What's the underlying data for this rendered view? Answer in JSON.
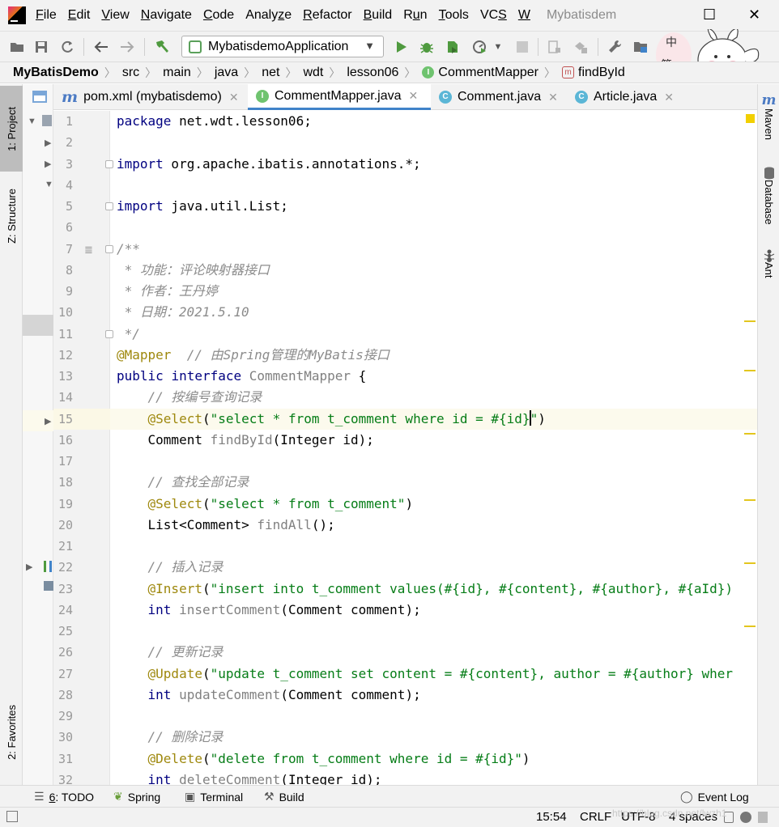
{
  "menubar": {
    "items": [
      {
        "label": "File",
        "mnemonic": "F"
      },
      {
        "label": "Edit",
        "mnemonic": "E"
      },
      {
        "label": "View",
        "mnemonic": "V"
      },
      {
        "label": "Navigate",
        "mnemonic": "N"
      },
      {
        "label": "Code",
        "mnemonic": "C"
      },
      {
        "label": "Analyze",
        "mnemonic": "z"
      },
      {
        "label": "Refactor",
        "mnemonic": "R"
      },
      {
        "label": "Build",
        "mnemonic": "B"
      },
      {
        "label": "Run",
        "mnemonic": "u"
      },
      {
        "label": "Tools",
        "mnemonic": "T"
      },
      {
        "label": "VCS",
        "mnemonic": "S"
      },
      {
        "label": "W",
        "mnemonic": "W"
      }
    ],
    "window_title": "Mybatisdem"
  },
  "toolbar": {
    "run_config": "MybatisdemoApplication"
  },
  "mascot": {
    "bubble_char1": "中",
    "bubble_char2": "简"
  },
  "breadcrumb": [
    "MyBatisDemo",
    "src",
    "main",
    "java",
    "net",
    "wdt",
    "lesson06",
    "CommentMapper",
    "findById"
  ],
  "left_strip": {
    "project_tab": "1: Project",
    "structure_tab": "Z: Structure",
    "favorites_tab": "2: Favorites"
  },
  "right_strip": {
    "maven": "Maven",
    "database": "Database",
    "ant": "Ant"
  },
  "tabs": [
    {
      "label": "pom.xml (mybatisdemo)",
      "icon": "maven-m-icon"
    },
    {
      "label": "CommentMapper.java",
      "icon": "interface-icon",
      "active": true
    },
    {
      "label": "Comment.java",
      "icon": "class-icon"
    },
    {
      "label": "Article.java",
      "icon": "class-icon"
    }
  ],
  "editor": {
    "current_line": 15,
    "lines": [
      {
        "n": "1",
        "t": "package net.wdt.lesson06;"
      },
      {
        "n": "2",
        "t": ""
      },
      {
        "n": "3",
        "t": "import org.apache.ibatis.annotations.*;"
      },
      {
        "n": "4",
        "t": ""
      },
      {
        "n": "5",
        "t": "import java.util.List;"
      },
      {
        "n": "6",
        "t": ""
      },
      {
        "n": "7",
        "t": "/**"
      },
      {
        "n": "8",
        "t": " * 功能：评论映射器接口"
      },
      {
        "n": "9",
        "t": " * 作者：王丹婷"
      },
      {
        "n": "10",
        "t": " * 日期：2021.5.10"
      },
      {
        "n": "11",
        "t": " */"
      },
      {
        "n": "12",
        "t": "@Mapper  // 由Spring管理的MyBatis接口"
      },
      {
        "n": "13",
        "t": "public interface CommentMapper {"
      },
      {
        "n": "14",
        "t": "    // 按编号查询记录"
      },
      {
        "n": "15",
        "t": "    @Select(\"select * from t_comment where id = #{id}\")"
      },
      {
        "n": "16",
        "t": "    Comment findById(Integer id);"
      },
      {
        "n": "17",
        "t": ""
      },
      {
        "n": "18",
        "t": "    // 查找全部记录"
      },
      {
        "n": "19",
        "t": "    @Select(\"select * from t_comment\")"
      },
      {
        "n": "20",
        "t": "    List<Comment> findAll();"
      },
      {
        "n": "21",
        "t": ""
      },
      {
        "n": "22",
        "t": "    // 插入记录"
      },
      {
        "n": "23",
        "t": "    @Insert(\"insert into t_comment values(#{id}, #{content}, #{author}, #{aId})"
      },
      {
        "n": "24",
        "t": "    int insertComment(Comment comment);"
      },
      {
        "n": "25",
        "t": ""
      },
      {
        "n": "26",
        "t": "    // 更新记录"
      },
      {
        "n": "27",
        "t": "    @Update(\"update t_comment set content = #{content}, author = #{author} wher"
      },
      {
        "n": "28",
        "t": "    int updateComment(Comment comment);"
      },
      {
        "n": "29",
        "t": ""
      },
      {
        "n": "30",
        "t": "    // 删除记录"
      },
      {
        "n": "31",
        "t": "    @Delete(\"delete from t_comment where id = #{id}\")"
      },
      {
        "n": "32",
        "t": "    int deleteComment(Integer id);"
      }
    ]
  },
  "bottom_tabs": [
    {
      "label": "6: TODO",
      "icon": "todo-list-icon"
    },
    {
      "label": "Spring",
      "icon": "spring-leaf-icon"
    },
    {
      "label": "Terminal",
      "icon": "terminal-icon"
    },
    {
      "label": "Build",
      "icon": "hammer-icon"
    },
    {
      "label": "Event Log",
      "icon": "event-log-icon"
    }
  ],
  "status_bar": {
    "position": "15:54",
    "line_separator": "CRLF",
    "encoding": "UTF-8",
    "indent": "4 spaces"
  },
  "watermark": "https://blog.csdn.net/lwzh1"
}
